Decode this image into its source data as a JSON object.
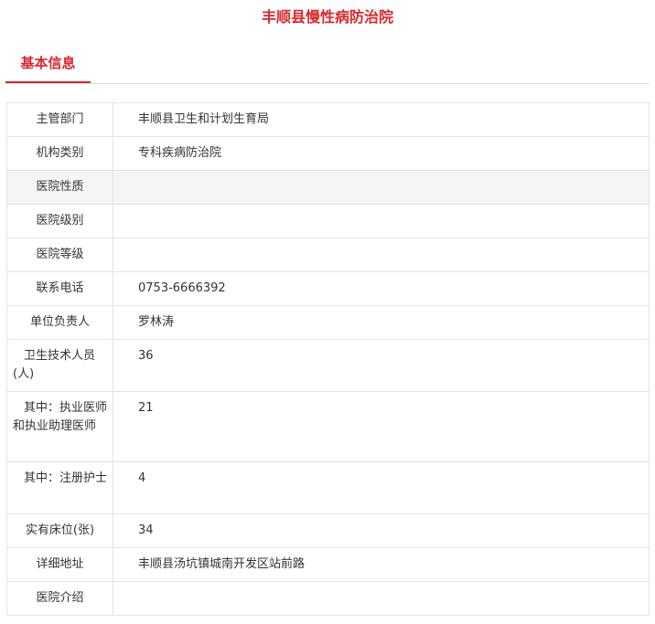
{
  "page_title": "丰顺县慢性病防治院",
  "tab": {
    "label": "基本信息"
  },
  "rows": [
    {
      "label": "主管部门",
      "value": "丰顺县卫生和计划生育局"
    },
    {
      "label": "机构类别",
      "value": "专科疾病防治院"
    },
    {
      "label": "医院性质",
      "value": ""
    },
    {
      "label": "医院级别",
      "value": ""
    },
    {
      "label": "医院等级",
      "value": ""
    },
    {
      "label": "联系电话",
      "value": "0753-6666392"
    },
    {
      "label": "单位负责人",
      "value": "罗林涛"
    },
    {
      "label": "卫生技术人员(人)",
      "value": "36"
    },
    {
      "label": "其中：执业医师和执业助理医师",
      "value": "21"
    },
    {
      "label": "其中：注册护士",
      "value": "4"
    },
    {
      "label": "实有床位(张)",
      "value": "34"
    },
    {
      "label": "详细地址",
      "value": "丰顺县汤坑镇城南开发区站前路"
    },
    {
      "label": "医院介绍",
      "value": ""
    }
  ],
  "colors": {
    "accent": "#d7282f",
    "border": "#e3e3e3",
    "row_highlight": "#f5f5f5"
  }
}
